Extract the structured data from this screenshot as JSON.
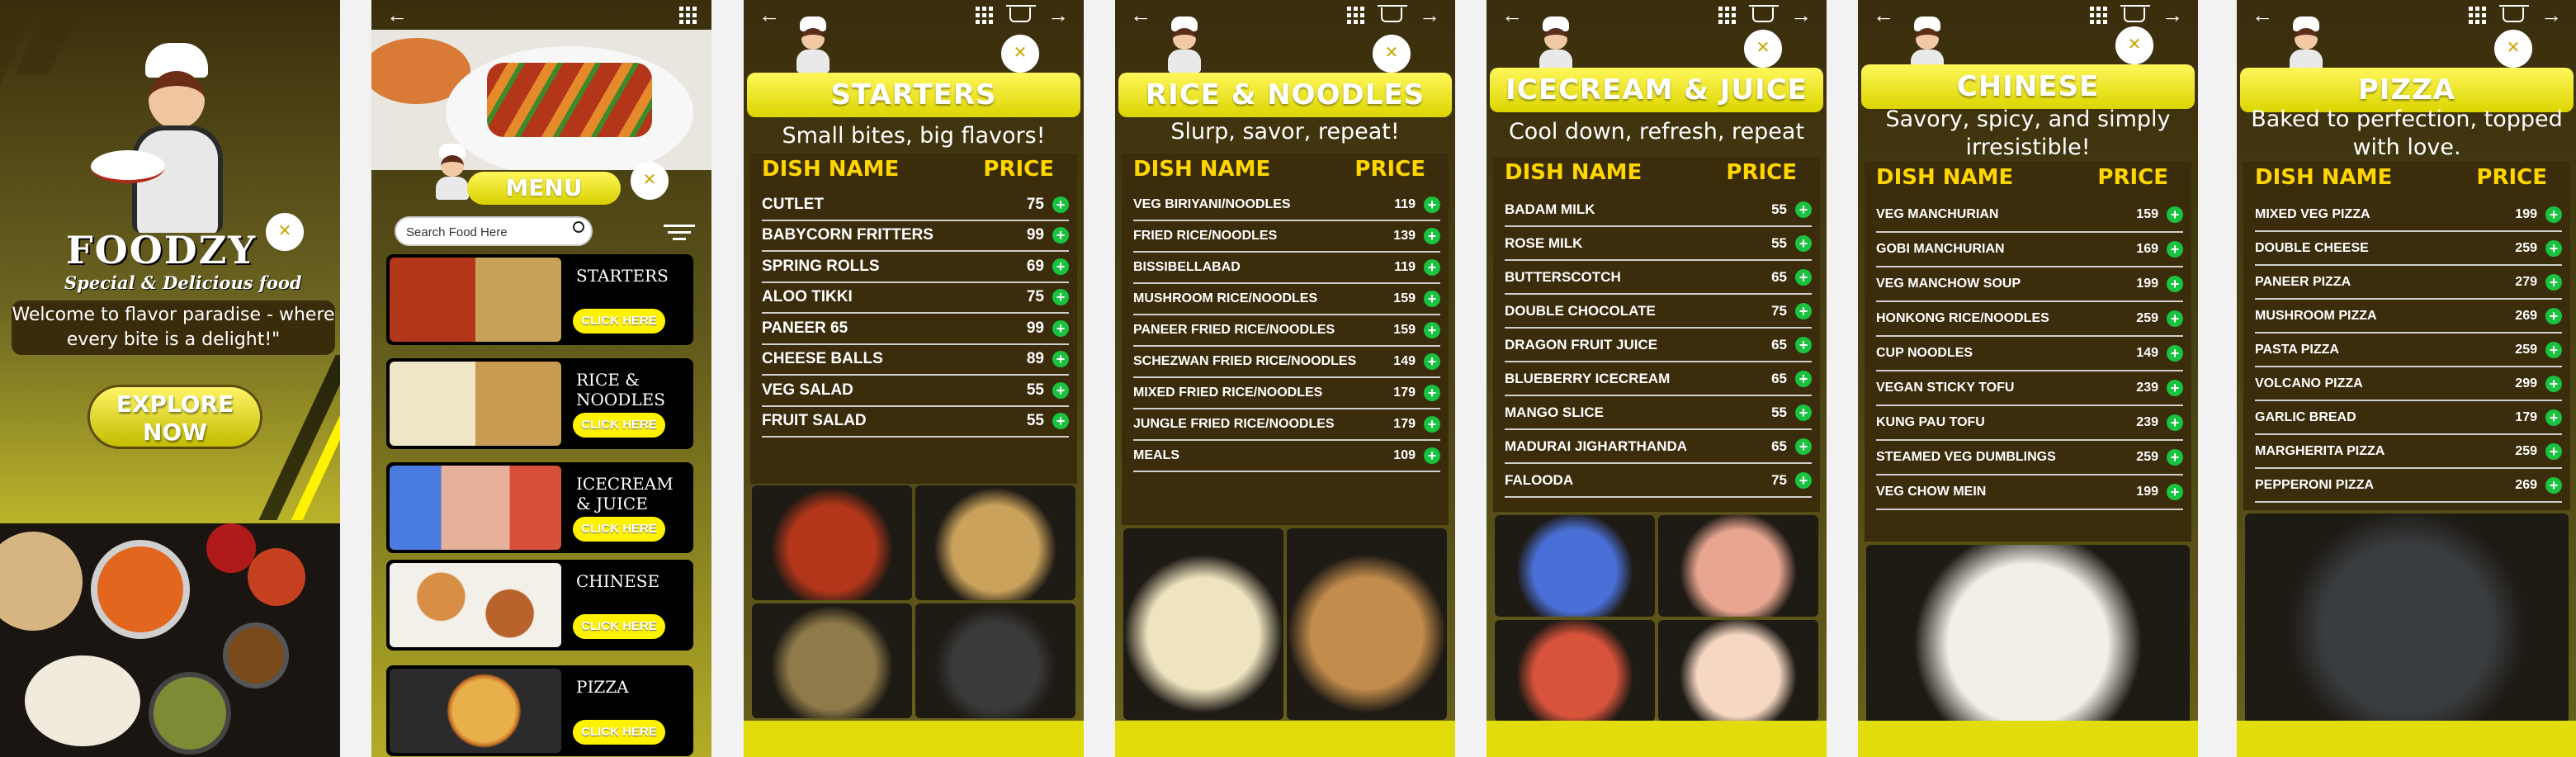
{
  "colors": {
    "dark": "#3b2c0c",
    "yellow": "#e3dc0b",
    "price_green": "#19c23f",
    "heading_yellow": "#ffd600"
  },
  "splash": {
    "brand": "FOODZY",
    "subtitle": "Special & Delicious food",
    "welcome": "Welcome to flavor paradise - where every bite is a delight!\"",
    "explore_label": "EXPLORE NOW"
  },
  "home": {
    "menu_label": "MENU",
    "search_placeholder": "Search Food Here",
    "categories": [
      {
        "label": "STARTERS",
        "button": "CLICK HERE"
      },
      {
        "label": "RICE & NOODLES",
        "button": "CLICK HERE"
      },
      {
        "label": "ICECREAM & JUICE",
        "button": "CLICK HERE"
      },
      {
        "label": "CHINESE",
        "button": "CLICK HERE"
      },
      {
        "label": "PIZZA",
        "button": "CLICK HERE"
      }
    ]
  },
  "common": {
    "dish_header": "DISH NAME",
    "price_header": "PRICE",
    "add_symbol": "+",
    "back": "←",
    "forward": "→"
  },
  "menus": [
    {
      "title": "STARTERS",
      "tagline": "Small bites, big flavors!",
      "items": [
        {
          "name": "CUTLET",
          "price": "75"
        },
        {
          "name": "BABYCORN FRITTERS",
          "price": "99"
        },
        {
          "name": "SPRING ROLLS",
          "price": "69"
        },
        {
          "name": "ALOO TIKKI",
          "price": "75"
        },
        {
          "name": "PANEER 65",
          "price": "99"
        },
        {
          "name": "CHEESE BALLS",
          "price": "89"
        },
        {
          "name": "VEG SALAD",
          "price": "55"
        },
        {
          "name": "FRUIT SALAD",
          "price": "55"
        }
      ]
    },
    {
      "title": "RICE & NOODLES",
      "tagline": "Slurp, savor, repeat!",
      "items": [
        {
          "name": "VEG BIRIYANI/NOODLES",
          "price": "119"
        },
        {
          "name": "FRIED RICE/NOODLES",
          "price": "139"
        },
        {
          "name": "BISSIBELLABAD",
          "price": "119"
        },
        {
          "name": "MUSHROOM RICE/NOODLES",
          "price": "159"
        },
        {
          "name": "PANEER FRIED RICE/NOODLES",
          "price": "159"
        },
        {
          "name": "SCHEZWAN FRIED RICE/NOODLES",
          "price": "149"
        },
        {
          "name": "MIXED FRIED RICE/NOODLES",
          "price": "179"
        },
        {
          "name": "JUNGLE FRIED RICE/NOODLES",
          "price": "179"
        },
        {
          "name": "MEALS",
          "price": "109"
        }
      ]
    },
    {
      "title": "ICECREAM & JUICE",
      "tagline": "Cool down, refresh, repeat",
      "items": [
        {
          "name": "BADAM MILK",
          "price": "55"
        },
        {
          "name": "ROSE MILK",
          "price": "55"
        },
        {
          "name": "BUTTERSCOTCH",
          "price": "65"
        },
        {
          "name": "DOUBLE CHOCOLATE",
          "price": "75"
        },
        {
          "name": "DRAGON FRUIT JUICE",
          "price": "65"
        },
        {
          "name": "BLUEBERRY ICECREAM",
          "price": "65"
        },
        {
          "name": "MANGO SLICE",
          "price": "55"
        },
        {
          "name": "MADURAI JIGHARTHANDA",
          "price": "65"
        },
        {
          "name": "FALOODA",
          "price": "75"
        }
      ]
    },
    {
      "title": "CHINESE",
      "tagline": "Savory, spicy, and simply irresistible!",
      "items": [
        {
          "name": "VEG MANCHURIAN",
          "price": "159"
        },
        {
          "name": "GOBI MANCHURIAN",
          "price": "169"
        },
        {
          "name": "VEG MANCHOW SOUP",
          "price": "199"
        },
        {
          "name": "HONKONG RICE/NOODLES",
          "price": "259"
        },
        {
          "name": "CUP NOODLES",
          "price": "149"
        },
        {
          "name": "VEGAN STICKY TOFU",
          "price": "239"
        },
        {
          "name": "KUNG PAU TOFU",
          "price": "239"
        },
        {
          "name": "STEAMED VEG DUMBLINGS",
          "price": "259"
        },
        {
          "name": "VEG CHOW MEIN",
          "price": "199"
        }
      ]
    },
    {
      "title": "PIZZA",
      "tagline": "Baked to perfection, topped with love.",
      "items": [
        {
          "name": "MIXED VEG PIZZA",
          "price": "199"
        },
        {
          "name": "DOUBLE CHEESE",
          "price": "259"
        },
        {
          "name": "PANEER PIZZA",
          "price": "279"
        },
        {
          "name": "MUSHROOM PIZZA",
          "price": "269"
        },
        {
          "name": "PASTA PIZZA",
          "price": "259"
        },
        {
          "name": "VOLCANO PIZZA",
          "price": "299"
        },
        {
          "name": "GARLIC BREAD",
          "price": "179"
        },
        {
          "name": "MARGHERITA PIZZA",
          "price": "259"
        },
        {
          "name": "PEPPERONI PIZZA",
          "price": "269"
        }
      ]
    }
  ]
}
